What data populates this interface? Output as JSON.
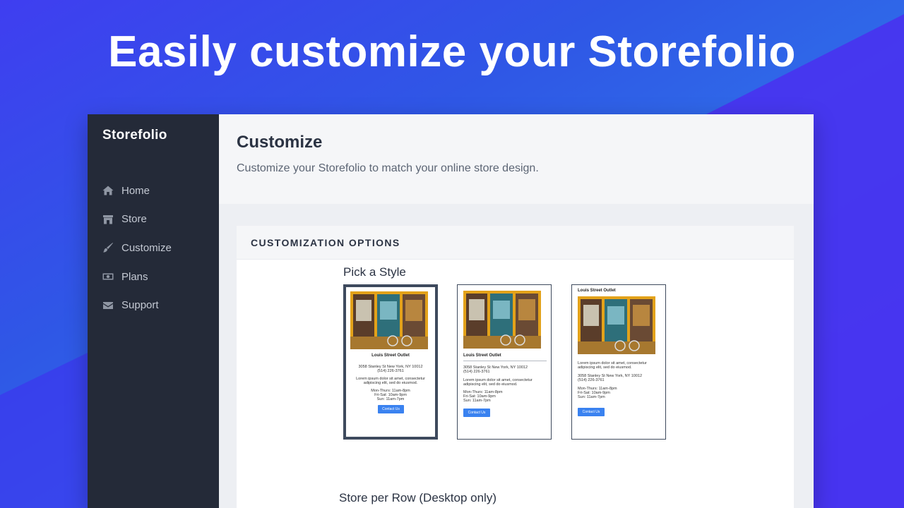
{
  "headline": "Easily customize your Storefolio",
  "colors": {
    "accent_blue": "#3a82f0",
    "sidebar_bg": "#242a38",
    "selected_border": "#3e4a5d"
  },
  "sidebar": {
    "brand": "Storefolio",
    "items": [
      {
        "label": "Home",
        "icon": "home-icon"
      },
      {
        "label": "Store",
        "icon": "store-icon"
      },
      {
        "label": "Customize",
        "icon": "brush-icon"
      },
      {
        "label": "Plans",
        "icon": "money-icon"
      },
      {
        "label": "Support",
        "icon": "envelope-icon"
      }
    ]
  },
  "page": {
    "title": "Customize",
    "subtitle": "Customize your Storefolio to match your online store design."
  },
  "card": {
    "header": "CUSTOMIZATION OPTIONS",
    "pick_style": "Pick a Style",
    "store_per_row": "Store per Row (Desktop only)"
  },
  "preview": {
    "store_name": "Louis Street Outlet",
    "address": "3058 Stanley St New York, NY 10012",
    "phone": "(514) 226-3761",
    "desc_line1": "Lorem ipsum dolor sit amet, consectetur",
    "desc_line2": "adipiscing elit, sed do eiusmod.",
    "hours_1": "Mon-Thurs: 11am-8pm",
    "hours_2": "Fri-Sat: 10am-9pm",
    "hours_3": "Sun: 11am-7pm",
    "button": "Contact Us"
  }
}
